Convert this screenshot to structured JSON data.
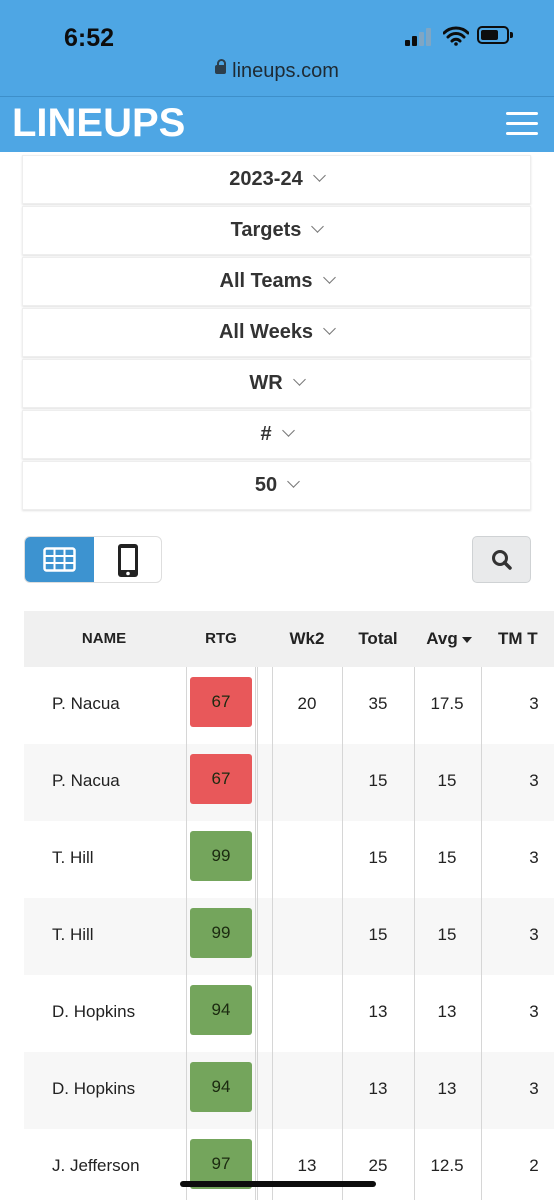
{
  "status": {
    "time": "6:52",
    "url": "lineups.com"
  },
  "navbar": {
    "logo": "LINEUPS"
  },
  "filters": [
    "2023-24",
    "Targets",
    "All Teams",
    "All Weeks",
    "WR",
    "#",
    "50"
  ],
  "table": {
    "columns": [
      "NAME",
      "RTG",
      "Wk2",
      "Total",
      "Avg",
      "TM T"
    ],
    "rows": [
      {
        "name": "P. Nacua",
        "rtg": "67",
        "rtg_color": "#e8585a",
        "wk2": "20",
        "total": "35",
        "avg": "17.5",
        "tm": "3"
      },
      {
        "name": "P. Nacua",
        "rtg": "67",
        "rtg_color": "#e8585a",
        "wk2": "",
        "total": "15",
        "avg": "15",
        "tm": "3"
      },
      {
        "name": "T. Hill",
        "rtg": "99",
        "rtg_color": "#74a55c",
        "wk2": "",
        "total": "15",
        "avg": "15",
        "tm": "3"
      },
      {
        "name": "T. Hill",
        "rtg": "99",
        "rtg_color": "#74a55c",
        "wk2": "",
        "total": "15",
        "avg": "15",
        "tm": "3"
      },
      {
        "name": "D. Hopkins",
        "rtg": "94",
        "rtg_color": "#74a55c",
        "wk2": "",
        "total": "13",
        "avg": "13",
        "tm": "3"
      },
      {
        "name": "D. Hopkins",
        "rtg": "94",
        "rtg_color": "#74a55c",
        "wk2": "",
        "total": "13",
        "avg": "13",
        "tm": "3"
      },
      {
        "name": "J. Jefferson",
        "rtg": "97",
        "rtg_color": "#74a55c",
        "wk2": "13",
        "total": "25",
        "avg": "12.5",
        "tm": "2"
      }
    ]
  },
  "colors": {
    "brand_blue": "#4ea6e4",
    "toggle_active": "#3d93d0",
    "rating_low": "#e8585a",
    "rating_high": "#74a55c"
  }
}
